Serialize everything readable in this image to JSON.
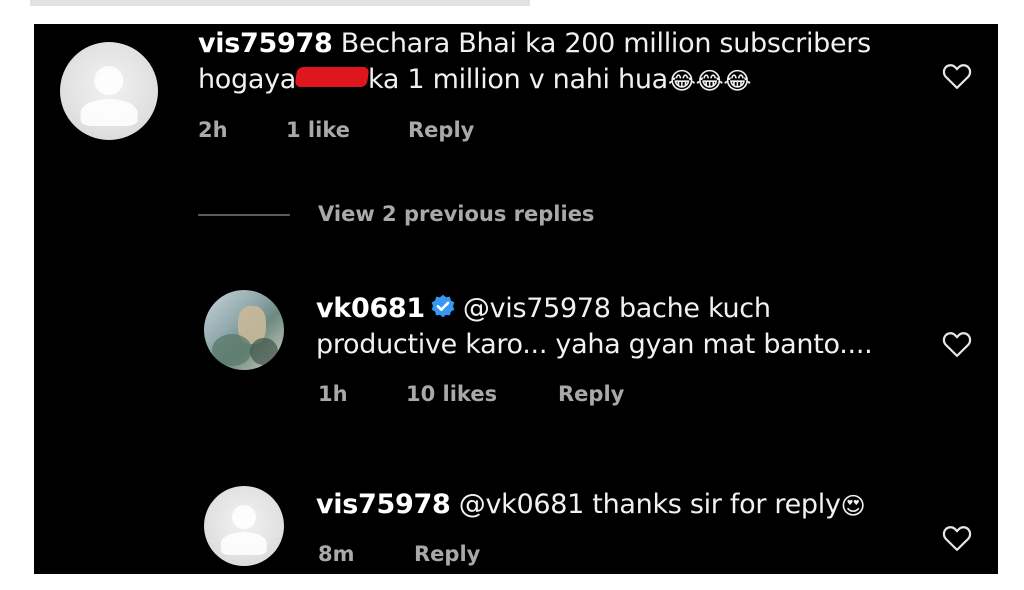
{
  "comments": [
    {
      "username": "vis75978",
      "text_part1": "Bechara Bhai ka 200 million subscribers",
      "text_part2_before_redaction": "hogaya",
      "text_part2_after_redaction": "ka 1 million v nahi hua",
      "emojis": "😂😂😂",
      "time": "2h",
      "likes": "1 like",
      "reply_label": "Reply"
    }
  ],
  "view_replies_label": "View 2 previous replies",
  "replies": [
    {
      "username": "vk0681",
      "verified": true,
      "mention": "@vis75978",
      "text_line1": "bache kuch",
      "text_line2": "productive karo... yaha gyan mat banto....",
      "time": "1h",
      "likes": "10 likes",
      "reply_label": "Reply"
    },
    {
      "username": "vis75978",
      "mention": "@vk0681",
      "text": "thanks sir for reply",
      "emoji": "😍",
      "time": "8m",
      "reply_label": "Reply"
    }
  ],
  "colors": {
    "background": "#000000",
    "text": "#f1f1f1",
    "meta": "#a9a9a9",
    "verified": "#3897f0",
    "redaction": "#e0161f"
  },
  "icons": {
    "like": "heart-outline-icon",
    "verified": "verified-badge-icon"
  }
}
